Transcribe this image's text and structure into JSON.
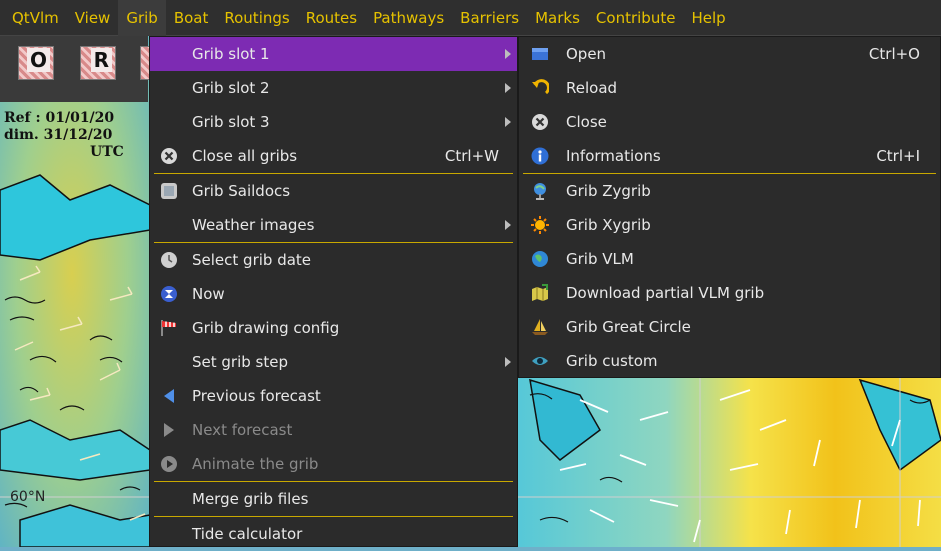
{
  "menubar": {
    "items": [
      "QtVlm",
      "View",
      "Grib",
      "Boat",
      "Routings",
      "Routes",
      "Pathways",
      "Barriers",
      "Marks",
      "Contribute",
      "Help"
    ],
    "active": "Grib"
  },
  "toolbar": {
    "buttons": [
      "O",
      "R"
    ]
  },
  "ref_info": {
    "ref_line": "Ref : 01/01/20",
    "date_line": "dim. 31/12/20",
    "tz": "UTC"
  },
  "map": {
    "lat_label": "60°N"
  },
  "grib_menu": {
    "items": [
      {
        "label": "Grib slot 1",
        "submenu": true,
        "highlighted": true
      },
      {
        "label": "Grib slot 2",
        "submenu": true
      },
      {
        "label": "Grib slot 3",
        "submenu": true
      },
      {
        "label": "Close all gribs",
        "shortcut": "Ctrl+W",
        "icon": "close-circle-icon"
      },
      {
        "label": "Grib Saildocs",
        "icon": "saildocs-icon"
      },
      {
        "label": "Weather images",
        "submenu": true
      },
      {
        "label": "Select grib date",
        "icon": "clock-icon"
      },
      {
        "label": "Now",
        "icon": "now-icon"
      },
      {
        "label": "Grib drawing config",
        "icon": "windsock-icon"
      },
      {
        "label": "Set grib step",
        "submenu": true
      },
      {
        "label": "Previous forecast",
        "icon": "triangle-left-icon"
      },
      {
        "label": "Next forecast",
        "icon": "triangle-right-icon",
        "disabled": true
      },
      {
        "label": "Animate the grib",
        "icon": "play-icon",
        "disabled": true
      },
      {
        "label": "Merge grib files"
      },
      {
        "label": "Tide calculator"
      }
    ]
  },
  "slot_menu": {
    "items": [
      {
        "label": "Open",
        "shortcut": "Ctrl+O",
        "icon": "open-folder-icon"
      },
      {
        "label": "Reload",
        "icon": "reload-icon"
      },
      {
        "label": "Close",
        "icon": "close-circle-icon"
      },
      {
        "label": "Informations",
        "shortcut": "Ctrl+I",
        "icon": "info-icon"
      },
      {
        "label": "Grib Zygrib",
        "icon": "globe-pin-icon"
      },
      {
        "label": "Grib Xygrib",
        "icon": "sun-icon"
      },
      {
        "label": "Grib VLM",
        "icon": "globe-icon"
      },
      {
        "label": "Download partial VLM grib",
        "icon": "map-download-icon"
      },
      {
        "label": "Grib Great Circle",
        "icon": "sailboat-icon"
      },
      {
        "label": "Grib custom",
        "icon": "eye-icon"
      }
    ]
  },
  "colors": {
    "menubar_text": "#e6c200",
    "highlight": "#7d2bb3",
    "separator": "#c8a800",
    "menu_bg": "#2b2b2b"
  }
}
